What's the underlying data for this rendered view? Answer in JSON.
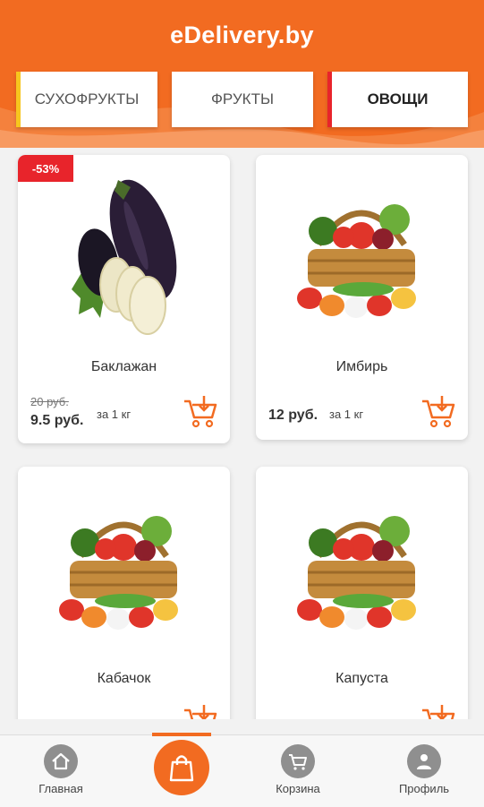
{
  "app": {
    "title": "eDelivery.by"
  },
  "colors": {
    "brand": "#f26b21",
    "discount": "#e8242b",
    "tab_accent_left": "#f7c61f",
    "tab_accent_right": "#e8242b"
  },
  "tabs": [
    {
      "label": "СУХОФРУКТЫ",
      "active": false
    },
    {
      "label": "ФРУКТЫ",
      "active": false
    },
    {
      "label": "ОВОЩИ",
      "active": true
    }
  ],
  "products": [
    {
      "name": "Баклажан",
      "badge": "-53%",
      "old_price": "20 руб.",
      "price": "9.5 руб.",
      "unit": "за 1 кг",
      "image": "eggplant"
    },
    {
      "name": "Имбирь",
      "price": "12 руб.",
      "unit": "за 1 кг",
      "image": "vegetable-basket"
    },
    {
      "name": "Кабачок",
      "image": "vegetable-basket"
    },
    {
      "name": "Капуста",
      "image": "vegetable-basket"
    }
  ],
  "nav": [
    {
      "label": "Главная",
      "icon": "home-icon"
    },
    {
      "label": "",
      "icon": "shopping-bag-icon",
      "active": true
    },
    {
      "label": "Корзина",
      "icon": "cart-icon"
    },
    {
      "label": "Профиль",
      "icon": "profile-icon"
    }
  ]
}
